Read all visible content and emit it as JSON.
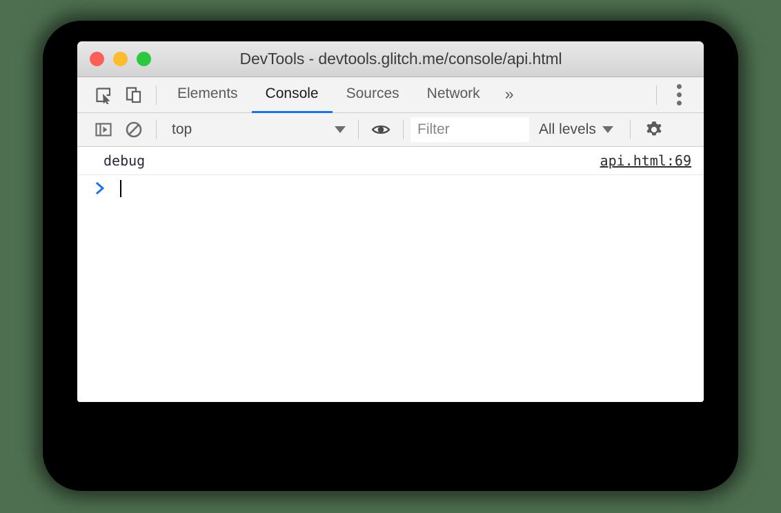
{
  "window": {
    "title": "DevTools - devtools.glitch.me/console/api.html",
    "traffic_lights": [
      {
        "name": "close",
        "color": "#fc5f57"
      },
      {
        "name": "minimize",
        "color": "#fdbc2e"
      },
      {
        "name": "maximize",
        "color": "#2bc840"
      }
    ]
  },
  "tabbar": {
    "icons": [
      {
        "name": "inspect-element-icon"
      },
      {
        "name": "device-toolbar-icon"
      }
    ],
    "tabs": [
      {
        "label": "Elements",
        "active": false
      },
      {
        "label": "Console",
        "active": true
      },
      {
        "label": "Sources",
        "active": false
      },
      {
        "label": "Network",
        "active": false
      }
    ],
    "more_tabs_label": "»",
    "menu_icon": "more-vertical-icon",
    "active_tab_color": "#1a73e8"
  },
  "console_toolbar": {
    "sidebar_toggle_icon": "console-sidebar-icon",
    "clear_icon": "clear-console-icon",
    "context_selected": "top",
    "eye_icon": "live-expression-eye-icon",
    "filter_value": "",
    "filter_placeholder": "Filter",
    "levels_label": "All levels",
    "settings_icon": "gear-icon"
  },
  "console": {
    "messages": [
      {
        "text": "debug",
        "source": "api.html:69"
      }
    ],
    "prompt_symbol": ">",
    "prompt_value": "",
    "prompt_color": "#1a73e8"
  }
}
